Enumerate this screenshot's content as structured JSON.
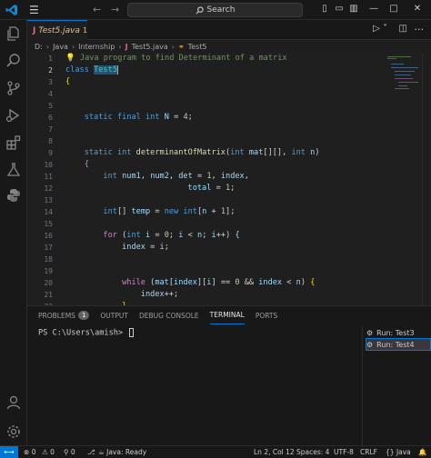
{
  "titlebar": {
    "search_label": "Search",
    "search_icon": "search-icon"
  },
  "tab": {
    "icon_letter": "J",
    "file_name": "Test5.java",
    "problem_count": "1"
  },
  "breadcrumb": {
    "drive": "D:",
    "folder1": "Java",
    "folder2": "Internship",
    "file_letter": "J",
    "file": "Test5.java",
    "class": "Test5"
  },
  "editor": {
    "line_numbers": [
      "1",
      "2",
      "3",
      "4",
      "5",
      "6",
      "7",
      "8",
      "9",
      "10",
      "11",
      "12",
      "13",
      "14",
      "15",
      "16",
      "17",
      "18",
      "19",
      "20",
      "21",
      "22",
      "23"
    ],
    "active_line": "2"
  },
  "panel": {
    "tabs": [
      "PROBLEMS",
      "OUTPUT",
      "DEBUG CONSOLE",
      "TERMINAL",
      "PORTS"
    ],
    "problems_badge": "1",
    "active_tab": "TERMINAL",
    "terminal_prompt": "PS C:\\Users\\amish> ",
    "terminals": [
      "Run: Test3",
      "Run: Test4"
    ]
  },
  "statusbar": {
    "errors": "0",
    "warnings": "0",
    "ports": "0",
    "java_status": "Java: Ready",
    "position": "Ln 2, Col 12",
    "spaces": "Spaces: 4",
    "encoding": "UTF-8",
    "eol": "CRLF",
    "language": "Java"
  },
  "colors": {
    "accent": "#0078d4",
    "editor_bg": "#1f1f1f",
    "keyword": "#569cd6",
    "type": "#4ec9b0",
    "function": "#dcdcaa",
    "comment": "#6a9955"
  }
}
